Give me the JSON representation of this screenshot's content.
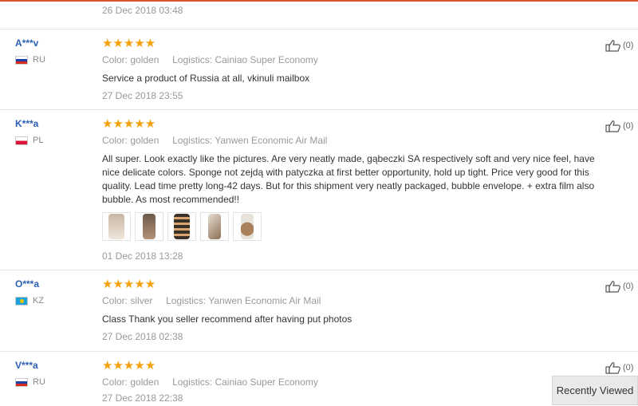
{
  "top": {
    "date": "26 Dec 2018 03:48"
  },
  "reviews": [
    {
      "user": "A***v",
      "country": "RU",
      "stars": "★★★★★",
      "rating": 5,
      "color_label": "Color:",
      "color": "golden",
      "logistics_label": "Logistics:",
      "logistics": "Cainiao Super Economy",
      "text": "Service a product of Russia at all, vkinuli mailbox",
      "date": "27 Dec 2018 23:55",
      "likes": "(0)"
    },
    {
      "user": "K***a",
      "country": "PL",
      "stars": "★★★★★",
      "rating": 5,
      "color_label": "Color:",
      "color": "golden",
      "logistics_label": "Logistics:",
      "logistics": "Yanwen Economic Air Mail",
      "text": "All super. Look exactly like the pictures. Are very neatly made, gąbeczki SA respectively soft and very nice feel, have nice delicate colors. Sponge not zejdą with patyczka at first better opportunity, hold up tight. Price very good for this quality. Lead time pretty long-42 days. But for this shipment very neatly packaged, bubble envelope. + extra film also bubble. As most recommended!!",
      "date": "01 Dec 2018 13:28",
      "likes": "(0)",
      "photos": 5
    },
    {
      "user": "O***a",
      "country": "KZ",
      "stars": "★★★★★",
      "rating": 5,
      "color_label": "Color:",
      "color": "silver",
      "logistics_label": "Logistics:",
      "logistics": "Yanwen Economic Air Mail",
      "text": "Class Thank you seller recommend after having put photos",
      "date": "27 Dec 2018 02:38",
      "likes": "(0)"
    },
    {
      "user": "V***a",
      "country": "RU",
      "stars": "★★★★★",
      "rating": 5,
      "color_label": "Color:",
      "color": "golden",
      "logistics_label": "Logistics:",
      "logistics": "Cainiao Super Economy",
      "date": "27 Dec 2018 22:38",
      "likes": "(0)"
    }
  ],
  "recently_viewed": "Recently Viewed",
  "icons": {
    "like": "thumbs-up-icon",
    "star": "star-icon"
  },
  "colors": {
    "star": "#f4a10d",
    "username": "#2c5fb3",
    "accent": "#d9532c"
  }
}
